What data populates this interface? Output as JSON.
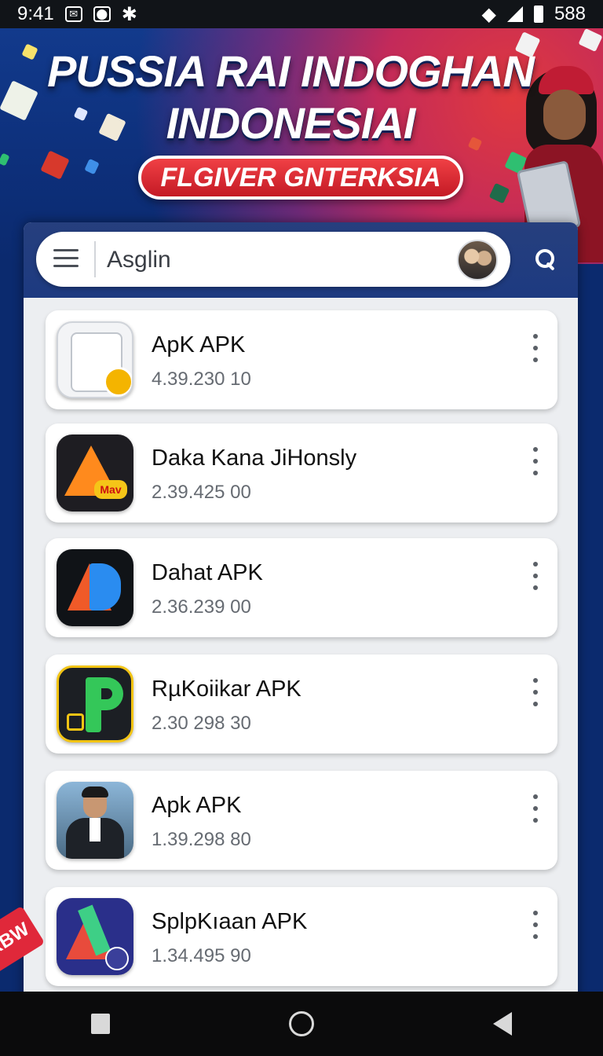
{
  "status_bar": {
    "time": "9:41",
    "battery": "588"
  },
  "banner": {
    "title_line1": "PUSSIA RAI INDOGHAN",
    "title_line2": "INDONESIAI",
    "pill_text": "FLGIVER GNTERKSIA"
  },
  "search": {
    "placeholder": "Asglin"
  },
  "apps": [
    {
      "name": "ApK APK",
      "version": "4.39.230 10"
    },
    {
      "name": "Daka Kana JiHonsly",
      "version": "2.39.425 00"
    },
    {
      "name": "Dahat APK",
      "version": "2.36.239 00"
    },
    {
      "name": "RµKoiikar APK",
      "version": "2.30 298 30"
    },
    {
      "name": "Apk APK",
      "version": "1.39.298 80"
    },
    {
      "name": "SplpKıaan APK",
      "version": "1.34.495 90"
    }
  ],
  "icons": {
    "menu": "hamburger-icon",
    "search": "search-icon",
    "more": "more-vertical-icon",
    "nav_recents": "square-icon",
    "nav_home": "circle-icon",
    "nav_back": "triangle-back-icon"
  },
  "colors": {
    "banner_bg": "#0d2f7a",
    "accent_red": "#d42430",
    "card_bg": "#eceef1"
  },
  "side_sticker": "RBW",
  "app_icon_badge": "Mav"
}
